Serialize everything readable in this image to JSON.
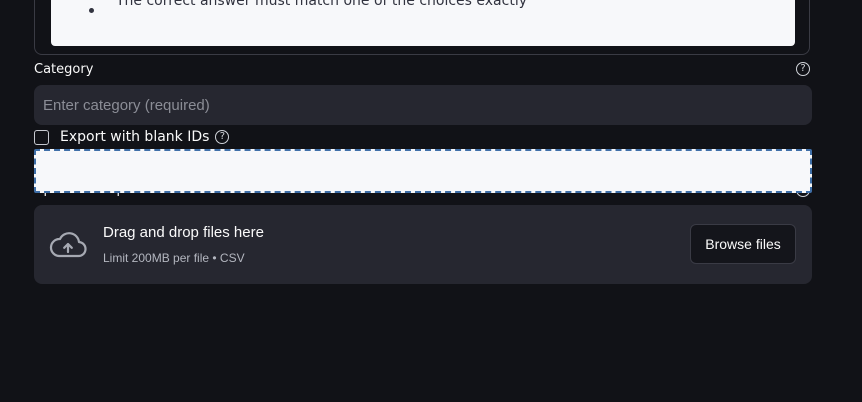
{
  "info": {
    "bullet": "The correct answer must match one of the choices exactly"
  },
  "category": {
    "label": "Category",
    "placeholder": "Enter category (required)",
    "help_icon": "question-circle"
  },
  "export": {
    "checkbox_label": "Export with blank IDs",
    "checked": false,
    "help_icon": "question-circle"
  },
  "uploader": {
    "label": "Upload raw question CSV files",
    "help_icon": "question-circle",
    "drop_title": "Drag and drop files here",
    "limit_text": "Limit 200MB per file • CSV",
    "browse_label": "Browse files",
    "upload_icon": "cloud-upload"
  },
  "colors": {
    "background": "#111217",
    "surface": "#262730",
    "highlight_border": "#3f6fa8",
    "highlight_fill": "#f7f8fa"
  }
}
